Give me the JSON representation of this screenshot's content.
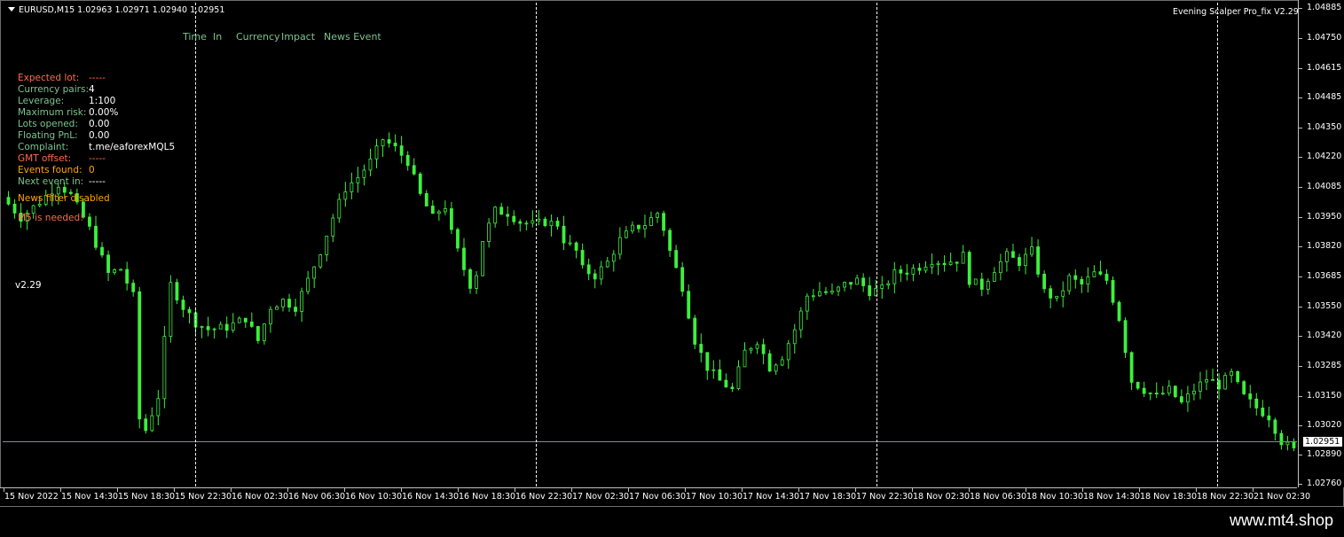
{
  "chart": {
    "symbol_title": "EURUSD,M15  1.02963 1.02971 1.02940 1.02951",
    "ea_name": "Evening Scalper Pro_fix V2.29",
    "current_price": "1.02951",
    "version": "v2.29",
    "candle_color": "#3cf03c",
    "background_color": "#000000"
  },
  "news_header": [
    "Time",
    "In",
    "Currency",
    "Impact",
    "News Event"
  ],
  "info_panel": [
    {
      "label": "Expected lot:",
      "value": "-----",
      "label_color": "#ff6a4a",
      "value_color": "#ff6a4a"
    },
    {
      "label": "Currency pairs:",
      "value": "4",
      "label_color": "#7cc48f",
      "value_color": "#ffffff"
    },
    {
      "label": "Leverage:",
      "value": "1:100",
      "label_color": "#7cc48f",
      "value_color": "#ffffff"
    },
    {
      "label": "Maximum risk:",
      "value": "0.00%",
      "label_color": "#7cc48f",
      "value_color": "#ffffff"
    },
    {
      "label": "Lots opened:",
      "value": "0.00",
      "label_color": "#7cc48f",
      "value_color": "#ffffff"
    },
    {
      "label": "Floating PnL:",
      "value": "0.00",
      "label_color": "#7cc48f",
      "value_color": "#ffffff"
    },
    {
      "label": "Complaint:",
      "value": "t.me/eaforexMQL5",
      "label_color": "#7cc48f",
      "value_color": "#ffffff"
    },
    {
      "label": "GMT offset:",
      "value": "-----",
      "label_color": "#ff6a4a",
      "value_color": "#ff6a4a"
    },
    {
      "label": "Events found:",
      "value": "0",
      "label_color": "#ffa500",
      "value_color": "#ffa500"
    },
    {
      "label": "Next event in:",
      "value": "-----",
      "label_color": "#7cc48f",
      "value_color": "#ffffff"
    }
  ],
  "news_filter_text": "News filter disabled",
  "news_filter_color": "#ffa500",
  "warning_text": "M5 is needed!",
  "warning_color": "#ff6a4a",
  "price_axis": [
    "1.04885",
    "1.04750",
    "1.04615",
    "1.04485",
    "1.04350",
    "1.04220",
    "1.04085",
    "1.03950",
    "1.03820",
    "1.03685",
    "1.03550",
    "1.03420",
    "1.03285",
    "1.03150",
    "1.03020",
    "1.02890",
    "1.02760"
  ],
  "time_axis": [
    "15 Nov 2022",
    "15 Nov 14:30",
    "15 Nov 18:30",
    "15 Nov 22:30",
    "16 Nov 02:30",
    "16 Nov 06:30",
    "16 Nov 10:30",
    "16 Nov 14:30",
    "16 Nov 18:30",
    "16 Nov 22:30",
    "17 Nov 02:30",
    "17 Nov 06:30",
    "17 Nov 10:30",
    "17 Nov 14:30",
    "17 Nov 18:30",
    "17 Nov 22:30",
    "18 Nov 02:30",
    "18 Nov 06:30",
    "18 Nov 10:30",
    "18 Nov 14:30",
    "18 Nov 18:30",
    "18 Nov 22:30",
    "21 Nov 02:30"
  ],
  "watermark": "www.mt4.shop",
  "chart_data": {
    "type": "candlestick",
    "ylim": [
      1.0276,
      1.0489
    ],
    "current_price": 1.02951,
    "price_path": [
      [
        0,
        1.0404
      ],
      [
        3,
        1.0395
      ],
      [
        6,
        1.0402
      ],
      [
        9,
        1.041
      ],
      [
        11,
        1.0405
      ],
      [
        14,
        1.039
      ],
      [
        17,
        1.037
      ],
      [
        19,
        1.0372
      ],
      [
        21,
        1.036
      ],
      [
        22,
        1.0305
      ],
      [
        23,
        1.03
      ],
      [
        25,
        1.0315
      ],
      [
        27,
        1.0365
      ],
      [
        29,
        1.0355
      ],
      [
        31,
        1.0348
      ],
      [
        33,
        1.0345
      ],
      [
        36,
        1.0346
      ],
      [
        39,
        1.035
      ],
      [
        41,
        1.034
      ],
      [
        43,
        1.0355
      ],
      [
        45,
        1.0358
      ],
      [
        47,
        1.0355
      ],
      [
        49,
        1.0367
      ],
      [
        51,
        1.038
      ],
      [
        53,
        1.0395
      ],
      [
        55,
        1.0408
      ],
      [
        57,
        1.0413
      ],
      [
        59,
        1.042
      ],
      [
        61,
        1.043
      ],
      [
        63,
        1.0426
      ],
      [
        65,
        1.042
      ],
      [
        67,
        1.0405
      ],
      [
        69,
        1.0395
      ],
      [
        70,
        1.0398
      ],
      [
        71,
        1.04
      ],
      [
        72,
        1.0388
      ],
      [
        73,
        1.038
      ],
      [
        74,
        1.0372
      ],
      [
        75,
        1.0365
      ],
      [
        76,
        1.037
      ],
      [
        77,
        1.0385
      ],
      [
        79,
        1.0398
      ],
      [
        81,
        1.0397
      ],
      [
        83,
        1.0393
      ],
      [
        85,
        1.0392
      ],
      [
        87,
        1.0393
      ],
      [
        89,
        1.0392
      ],
      [
        90,
        1.0385
      ],
      [
        92,
        1.038
      ],
      [
        93,
        1.0372
      ],
      [
        95,
        1.0369
      ],
      [
        97,
        1.0375
      ],
      [
        99,
        1.0385
      ],
      [
        101,
        1.039
      ],
      [
        103,
        1.0392
      ],
      [
        105,
        1.0397
      ],
      [
        106,
        1.039
      ],
      [
        107,
        1.038
      ],
      [
        109,
        1.0364
      ],
      [
        111,
        1.034
      ],
      [
        113,
        1.0328
      ],
      [
        115,
        1.0322
      ],
      [
        117,
        1.0318
      ],
      [
        119,
        1.0335
      ],
      [
        121,
        1.034
      ],
      [
        123,
        1.0328
      ],
      [
        125,
        1.0333
      ],
      [
        127,
        1.0345
      ],
      [
        129,
        1.036
      ],
      [
        131,
        1.0362
      ],
      [
        133,
        1.0361
      ],
      [
        135,
        1.0365
      ],
      [
        137,
        1.0367
      ],
      [
        139,
        1.0362
      ],
      [
        141,
        1.0363
      ],
      [
        143,
        1.037
      ],
      [
        145,
        1.0371
      ],
      [
        147,
        1.0373
      ],
      [
        149,
        1.0376
      ],
      [
        151,
        1.0375
      ],
      [
        153,
        1.0376
      ],
      [
        154,
        1.0378
      ],
      [
        155,
        1.0367
      ],
      [
        157,
        1.0364
      ],
      [
        159,
        1.0372
      ],
      [
        161,
        1.0378
      ],
      [
        163,
        1.0375
      ],
      [
        165,
        1.038
      ],
      [
        167,
        1.0362
      ],
      [
        169,
        1.0358
      ],
      [
        171,
        1.0368
      ],
      [
        173,
        1.0365
      ],
      [
        175,
        1.037
      ],
      [
        177,
        1.0367
      ],
      [
        179,
        1.035
      ],
      [
        181,
        1.0322
      ],
      [
        183,
        1.0318
      ],
      [
        185,
        1.0315
      ],
      [
        187,
        1.0318
      ],
      [
        189,
        1.0312
      ],
      [
        191,
        1.0318
      ],
      [
        193,
        1.0323
      ],
      [
        195,
        1.032
      ],
      [
        197,
        1.0325
      ],
      [
        199,
        1.0315
      ],
      [
        201,
        1.031
      ],
      [
        203,
        1.0306
      ],
      [
        205,
        1.0295
      ],
      [
        207,
        1.0291
      ]
    ],
    "candle_count": 207
  }
}
